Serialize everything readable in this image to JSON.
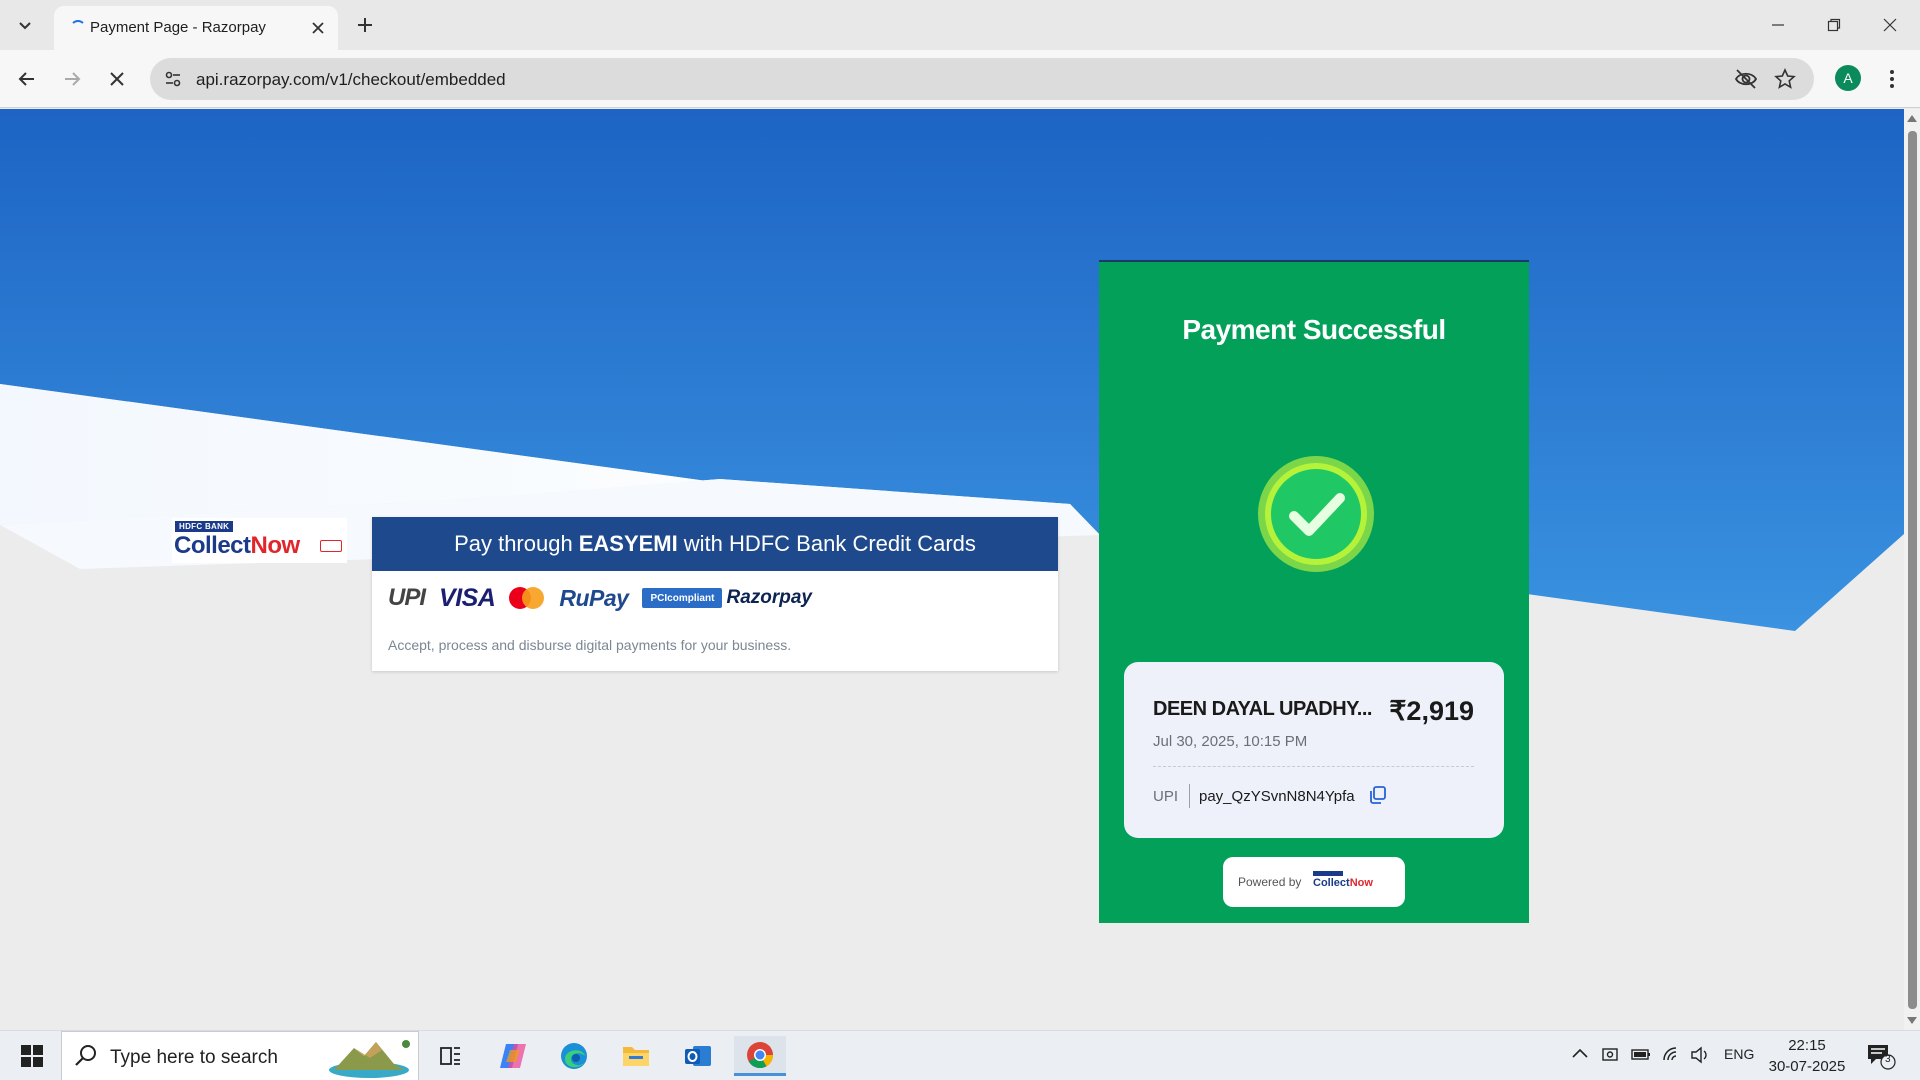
{
  "browser": {
    "tab_title": "Payment Page - Razorpay",
    "url": "api.razorpay.com/v1/checkout/embedded",
    "profile_initial": "A"
  },
  "page": {
    "brand_logo": {
      "bank_label": "HDFC BANK",
      "word_a": "Collect",
      "word_b": "Now"
    },
    "promo": {
      "banner_prefix": "Pay through",
      "banner_bold": "EASYEMI",
      "banner_suffix": "with HDFC Bank Credit Cards",
      "logos": {
        "upi": "UPI",
        "visa": "VISA",
        "rupay": "RuPay",
        "pci": "PCIcompliant",
        "razorpay": "Razorpay"
      },
      "tagline": "Accept, process and disburse digital payments for your business."
    },
    "payment": {
      "status_title": "Payment Successful",
      "merchant": "DEEN DAYAL UPADHY...",
      "amount": "₹2,919",
      "datetime": "Jul 30, 2025, 10:15 PM",
      "method": "UPI",
      "payment_id": "pay_QzYSvnN8N4Ypfa",
      "powered_by": "Powered by"
    },
    "colors": {
      "success_green": "#02a058",
      "banner_blue": "#1e4a8d",
      "hero_blue": "#2c7bd6"
    }
  },
  "taskbar": {
    "search_placeholder": "Type here to search",
    "language": "ENG",
    "time": "22:15",
    "date": "30-07-2025",
    "notification_count": "3"
  }
}
